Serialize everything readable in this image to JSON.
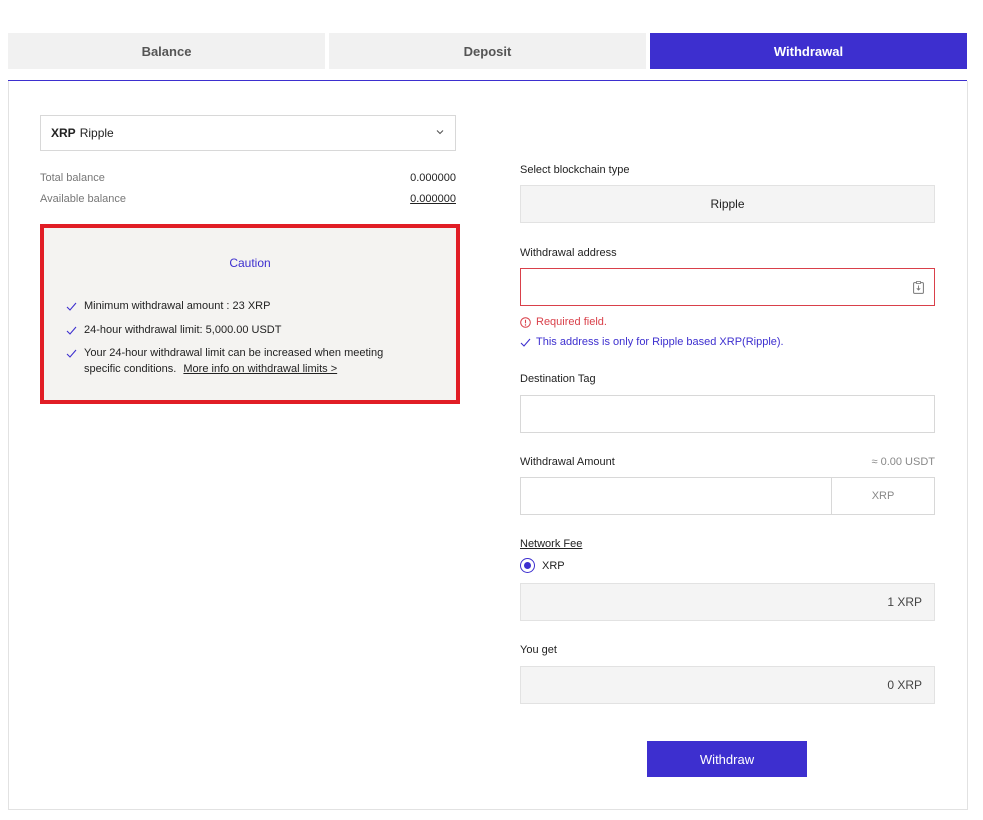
{
  "tabs": [
    {
      "label": "Balance",
      "active": false
    },
    {
      "label": "Deposit",
      "active": false
    },
    {
      "label": "Withdrawal",
      "active": true
    }
  ],
  "coin_select": {
    "symbol": "XRP",
    "name": "Ripple",
    "icon": "chevron-down-icon"
  },
  "balances": {
    "total_label": "Total balance",
    "total_value": "0.000000",
    "available_label": "Available balance",
    "available_value": "0.000000"
  },
  "caution": {
    "title": "Caution",
    "items": [
      "Minimum withdrawal amount : 23 XRP",
      "24-hour withdrawal limit: 5,000.00 USDT",
      "Your 24-hour withdrawal limit can be increased when meeting specific conditions."
    ],
    "link": "More info on withdrawal limits >"
  },
  "form": {
    "chain_label": "Select blockchain type",
    "chain_value": "Ripple",
    "address_label": "Withdrawal address",
    "address_value": "",
    "address_error": "Required field.",
    "address_note": "This address is only for Ripple based XRP(Ripple).",
    "tag_label": "Destination Tag",
    "tag_value": "",
    "amount_label": "Withdrawal Amount",
    "amount_approx": "≈ 0.00 USDT",
    "amount_value": "",
    "amount_unit": "XRP",
    "fee_label": "Network Fee",
    "fee_option": "XRP",
    "fee_value": "1 XRP",
    "youget_label": "You get",
    "youget_value": "0 XRP",
    "submit_label": "Withdraw"
  },
  "colors": {
    "accent": "#3d2fcf",
    "error": "#d9404a",
    "highlight_border": "#e11d25"
  }
}
